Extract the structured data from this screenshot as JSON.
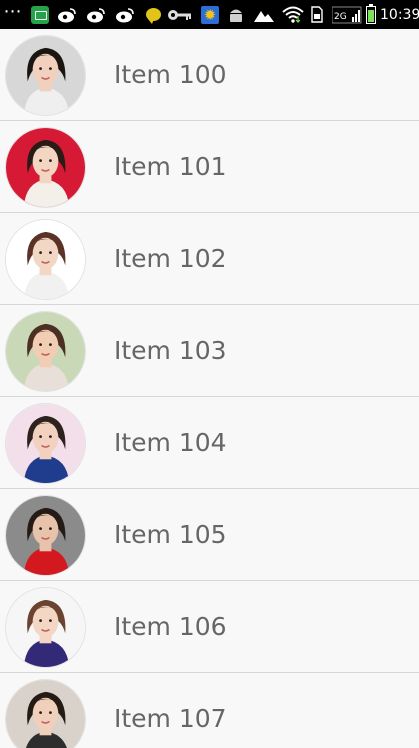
{
  "status_bar": {
    "time": "10:39",
    "icons": [
      "more-dots-icon",
      "message-icon",
      "weibo-icon",
      "weibo-icon",
      "weibo-icon",
      "chat-bubble-icon",
      "key-icon",
      "sun-app-icon",
      "android-icon",
      "mountain-icon",
      "wifi-icon",
      "sim-icon",
      "signal-icon",
      "battery-icon"
    ],
    "network_label": "2G"
  },
  "list": {
    "items": [
      {
        "label": "Item 100",
        "avatar": {
          "bg": "#d7d7d7",
          "hair": "#1b1512",
          "skin": "#f1d0bd",
          "clothes": "#efefef"
        }
      },
      {
        "label": "Item 101",
        "avatar": {
          "bg": "#d61a36",
          "hair": "#2a1b16",
          "skin": "#f2d6c2",
          "clothes": "#f3f0ea"
        }
      },
      {
        "label": "Item 102",
        "avatar": {
          "bg": "#ffffff",
          "hair": "#5a3326",
          "skin": "#f3d7c5",
          "clothes": "#f1f1f1"
        }
      },
      {
        "label": "Item 103",
        "avatar": {
          "bg": "#c9d8b7",
          "hair": "#4b2f22",
          "skin": "#f0cdb3",
          "clothes": "#e8e0d8"
        }
      },
      {
        "label": "Item 104",
        "avatar": {
          "bg": "#f3dfe9",
          "hair": "#2d221e",
          "skin": "#f2d2bf",
          "clothes": "#1f3c8d"
        }
      },
      {
        "label": "Item 105",
        "avatar": {
          "bg": "#8b8b8b",
          "hair": "#241a16",
          "skin": "#e8c3ac",
          "clothes": "#d3191f"
        }
      },
      {
        "label": "Item 106",
        "avatar": {
          "bg": "#f6f6f6",
          "hair": "#6a4331",
          "skin": "#f3d6c4",
          "clothes": "#322a77"
        }
      },
      {
        "label": "Item 107",
        "avatar": {
          "bg": "#d9d2cb",
          "hair": "#251b15",
          "skin": "#f0cfbb",
          "clothes": "#2d2d2d"
        }
      }
    ]
  }
}
